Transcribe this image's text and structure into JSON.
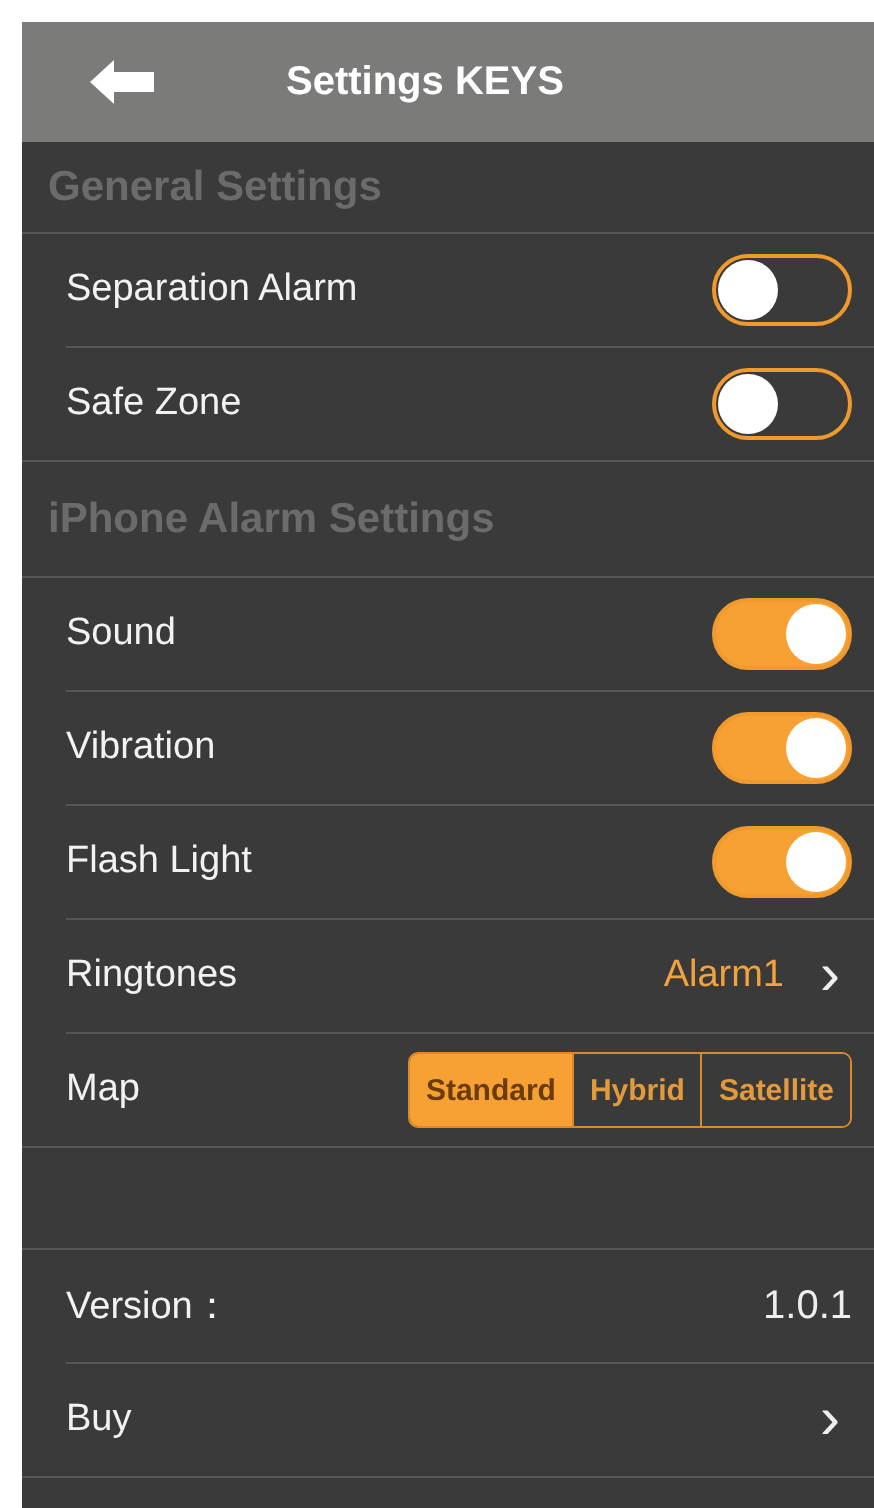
{
  "nav": {
    "title": "Settings KEYS"
  },
  "sections": [
    {
      "header": "General Settings",
      "items": [
        {
          "kind": "toggle",
          "label": "Separation Alarm",
          "on": false
        },
        {
          "kind": "toggle",
          "label": "Safe Zone",
          "on": false
        }
      ]
    },
    {
      "header": "iPhone Alarm Settings",
      "items": [
        {
          "kind": "toggle",
          "label": "Sound",
          "on": true
        },
        {
          "kind": "toggle",
          "label": "Vibration",
          "on": true
        },
        {
          "kind": "toggle",
          "label": "Flash Light",
          "on": true
        },
        {
          "kind": "link",
          "label": "Ringtones",
          "value": "Alarm1",
          "chevron": "›"
        },
        {
          "kind": "segmented",
          "label": "Map",
          "segments": [
            {
              "label": "Standard",
              "selected": true
            },
            {
              "label": "Hybrid",
              "selected": false
            },
            {
              "label": "Satellite",
              "selected": false
            }
          ]
        }
      ]
    },
    {
      "items": [
        {
          "kind": "value",
          "label": "Version：",
          "value": "1.0.1"
        },
        {
          "kind": "link",
          "label": "Buy",
          "chevron": "›"
        }
      ]
    }
  ]
}
